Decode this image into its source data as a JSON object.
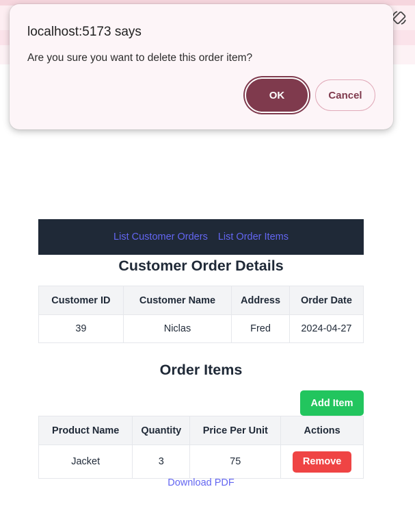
{
  "dialog": {
    "title": "localhost:5173 says",
    "message": "Are you sure you want to delete this order item?",
    "ok_label": "OK",
    "cancel_label": "Cancel"
  },
  "browser": {
    "rotate_icon": "screen-rotate-icon"
  },
  "nav": {
    "links": [
      "List Customer Orders",
      "List Order Items"
    ]
  },
  "customer_section": {
    "heading": "Customer Order Details",
    "columns": [
      "Customer ID",
      "Customer Name",
      "Address",
      "Order Date"
    ],
    "row": [
      "39",
      "Niclas",
      "Fred",
      "2024-04-27"
    ]
  },
  "items_section": {
    "heading": "Order Items",
    "add_label": "Add Item",
    "columns": [
      "Product Name",
      "Quantity",
      "Price Per Unit",
      "Actions"
    ],
    "rows": [
      {
        "product": "Jacket",
        "quantity": "3",
        "price": "75",
        "action_label": "Remove"
      }
    ]
  },
  "download_label": "Download PDF",
  "colors": {
    "navbar_bg": "#1f2937",
    "link": "#6366f1",
    "add_button": "#22c55e",
    "remove_button": "#ef4444",
    "dialog_ok": "#7f3a4d"
  }
}
